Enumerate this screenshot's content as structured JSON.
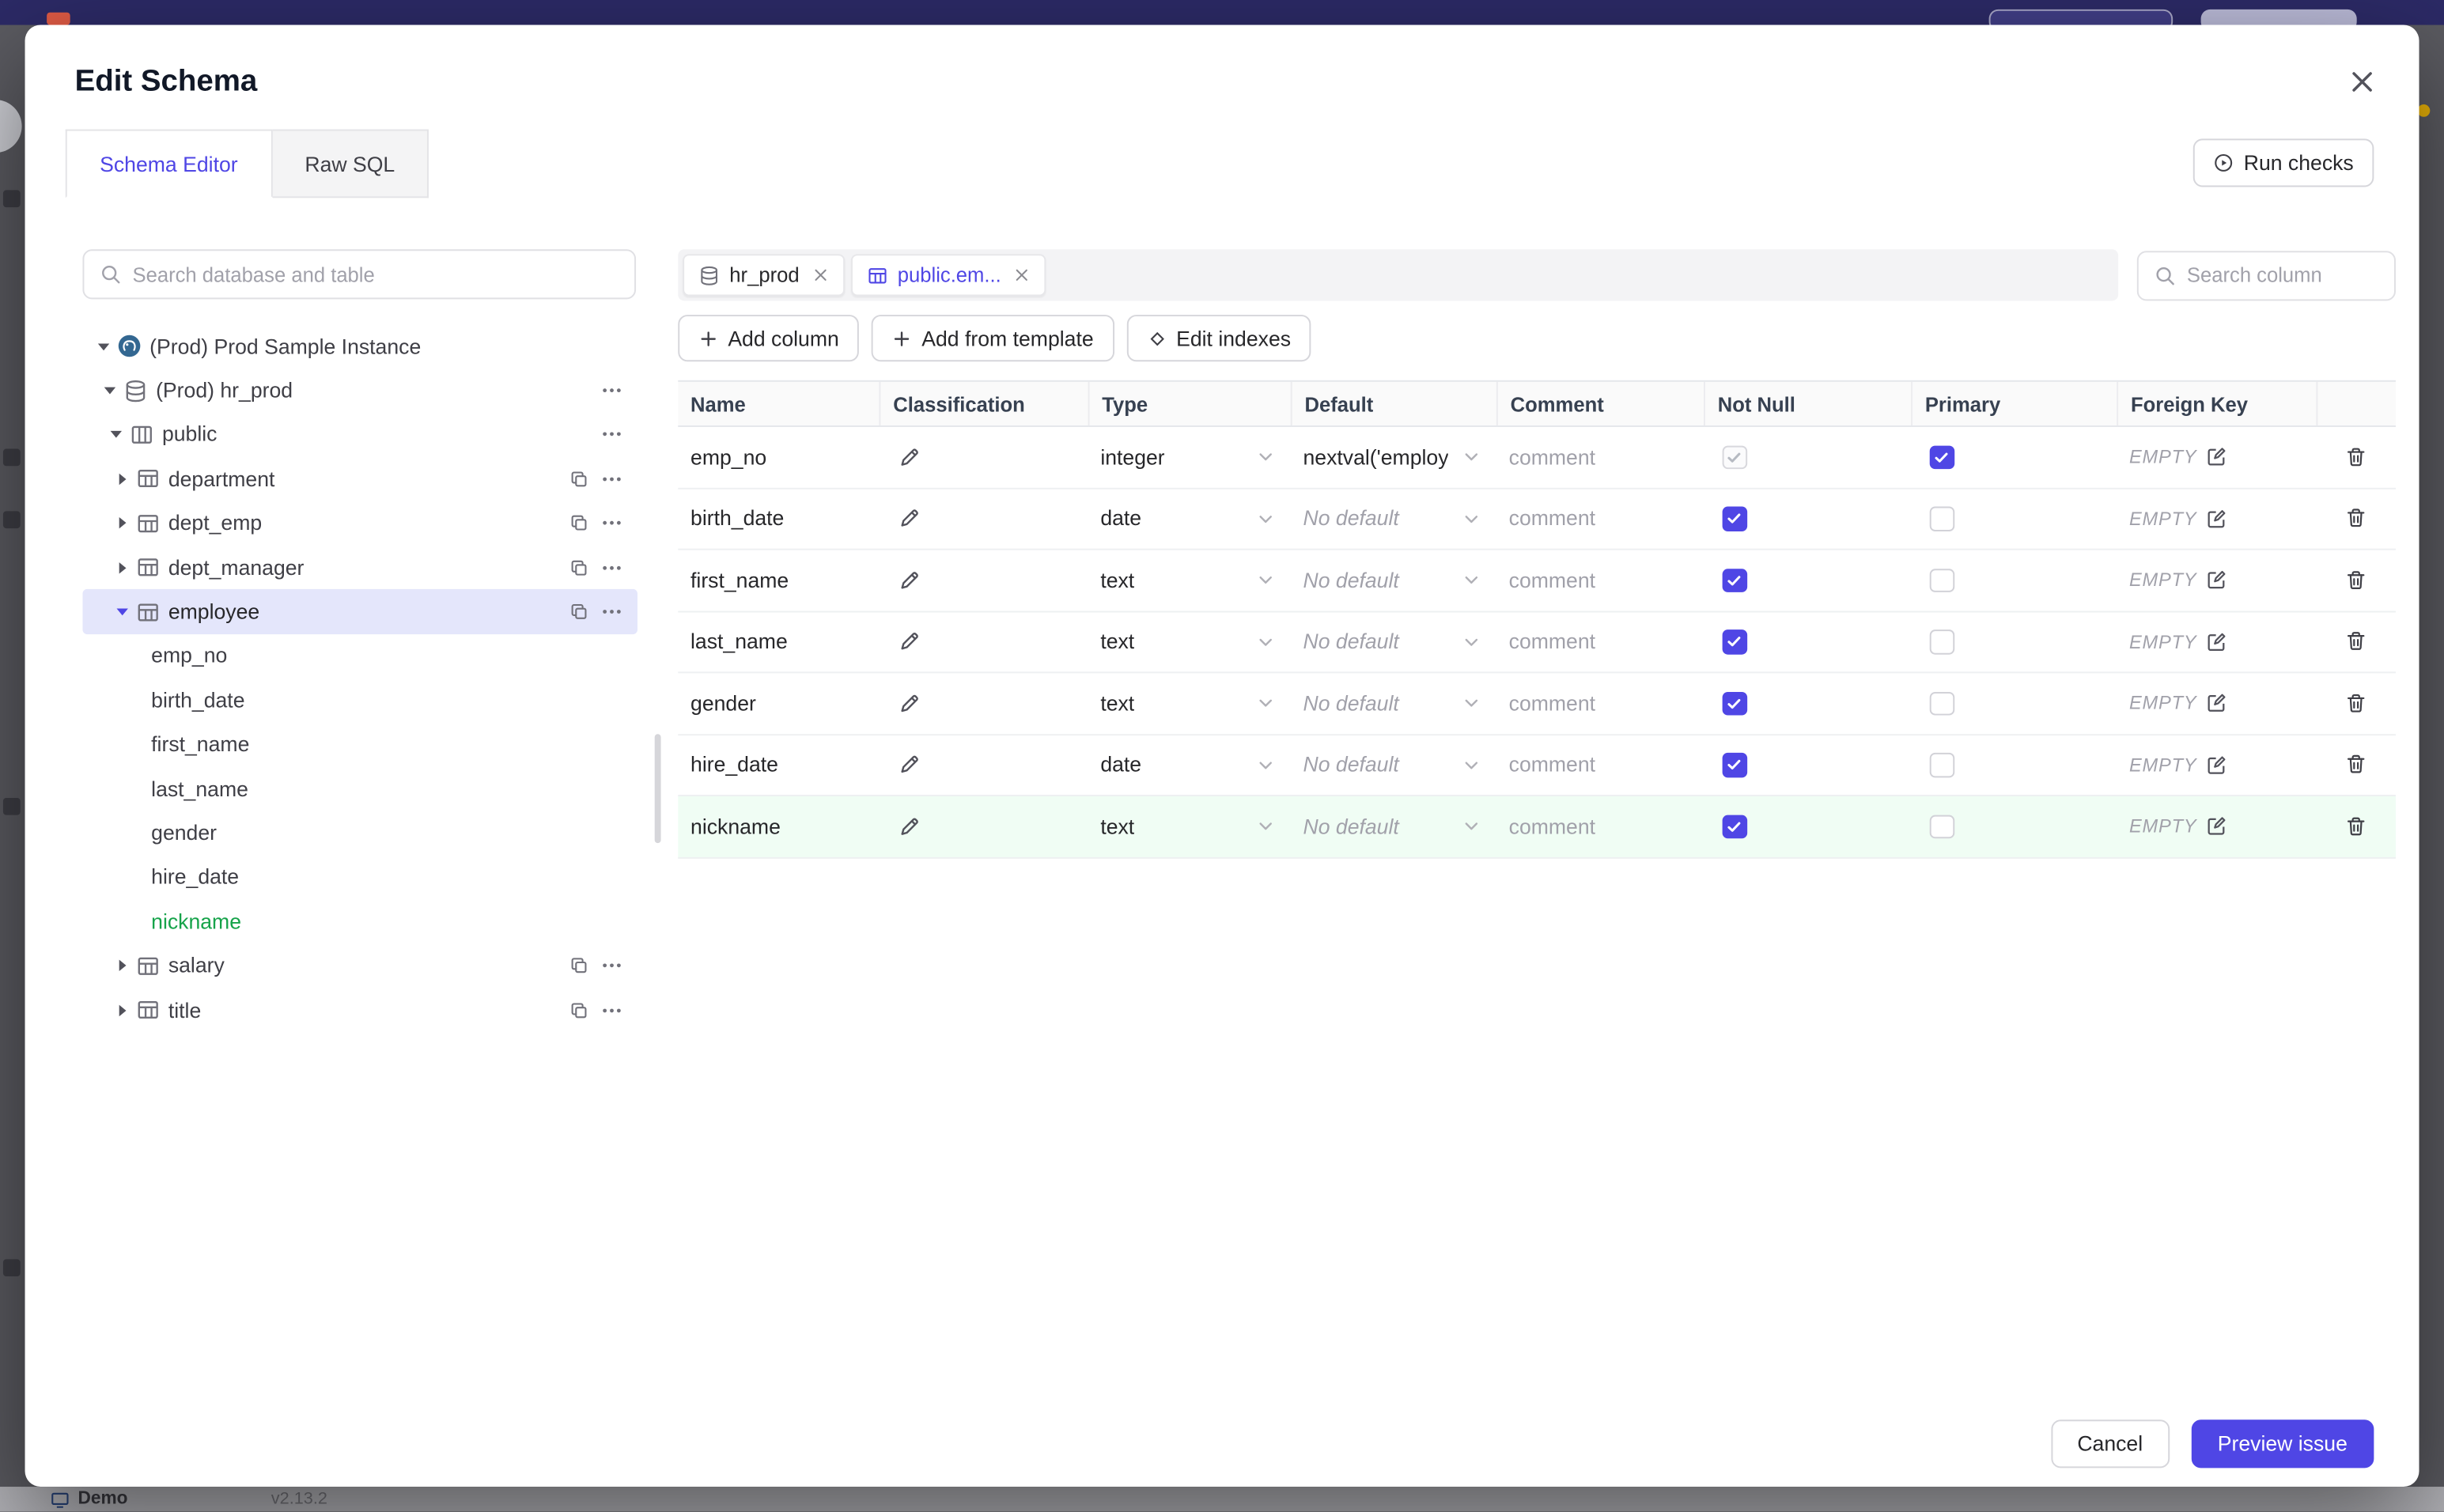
{
  "colors": {
    "accent": "#4f46e5",
    "green_text": "#16a34a",
    "green_row_bg": "#f0fdf4",
    "selected_bg": "#e4e6fb"
  },
  "backdrop": {
    "demo_label": "Demo",
    "version": "v2.13.2"
  },
  "modal": {
    "title": "Edit Schema",
    "tabs": [
      {
        "label": "Schema Editor",
        "active": true
      },
      {
        "label": "Raw SQL",
        "active": false
      }
    ],
    "run_checks_label": "Run checks",
    "sidebar": {
      "search_placeholder": "Search database and table",
      "tree": [
        {
          "label": "(Prod) Prod Sample Instance",
          "level": 0,
          "caret": "down",
          "icon": "instance"
        },
        {
          "label": "(Prod) hr_prod",
          "level": 1,
          "caret": "down",
          "icon": "database",
          "menu": true
        },
        {
          "label": "public",
          "level": 2,
          "caret": "down",
          "icon": "schema",
          "menu": true
        },
        {
          "label": "department",
          "level": 3,
          "caret": "right",
          "icon": "table",
          "copy": true,
          "menu": true
        },
        {
          "label": "dept_emp",
          "level": 3,
          "caret": "right",
          "icon": "table",
          "copy": true,
          "menu": true
        },
        {
          "label": "dept_manager",
          "level": 3,
          "caret": "right",
          "icon": "table",
          "copy": true,
          "menu": true
        },
        {
          "label": "employee",
          "level": 3,
          "caret": "down",
          "icon": "table",
          "copy": true,
          "menu": true,
          "selected": true
        },
        {
          "label": "emp_no",
          "level": 4
        },
        {
          "label": "birth_date",
          "level": 4
        },
        {
          "label": "first_name",
          "level": 4
        },
        {
          "label": "last_name",
          "level": 4
        },
        {
          "label": "gender",
          "level": 4
        },
        {
          "label": "hire_date",
          "level": 4
        },
        {
          "label": "nickname",
          "level": 4,
          "green": true
        },
        {
          "label": "salary",
          "level": 3,
          "caret": "right",
          "icon": "table",
          "copy": true,
          "menu": true
        },
        {
          "label": "title",
          "level": 3,
          "caret": "right",
          "icon": "table",
          "copy": true,
          "menu": true
        }
      ]
    },
    "main": {
      "chips": [
        {
          "label": "hr_prod",
          "icon": "database",
          "active": false
        },
        {
          "label": "public.em...",
          "icon": "table",
          "active": true
        }
      ],
      "column_search_placeholder": "Search column",
      "toolbar": {
        "add_column": "Add column",
        "add_from_template": "Add from template",
        "edit_indexes": "Edit indexes"
      },
      "table": {
        "headers": [
          "Name",
          "Classification",
          "Type",
          "Default",
          "Comment",
          "Not Null",
          "Primary",
          "Foreign Key",
          ""
        ],
        "comment_placeholder": "comment",
        "empty_label": "EMPTY",
        "rows": [
          {
            "name": "emp_no",
            "type": "integer",
            "default": "nextval('employ",
            "default_muted": false,
            "not_null": "checked-disabled",
            "primary": "checked",
            "highlight": false
          },
          {
            "name": "birth_date",
            "type": "date",
            "default": "No default",
            "default_muted": true,
            "not_null": "checked",
            "primary": "unchecked",
            "highlight": false
          },
          {
            "name": "first_name",
            "type": "text",
            "default": "No default",
            "default_muted": true,
            "not_null": "checked",
            "primary": "unchecked",
            "highlight": false
          },
          {
            "name": "last_name",
            "type": "text",
            "default": "No default",
            "default_muted": true,
            "not_null": "checked",
            "primary": "unchecked",
            "highlight": false
          },
          {
            "name": "gender",
            "type": "text",
            "default": "No default",
            "default_muted": true,
            "not_null": "checked",
            "primary": "unchecked",
            "highlight": false
          },
          {
            "name": "hire_date",
            "type": "date",
            "default": "No default",
            "default_muted": true,
            "not_null": "checked",
            "primary": "unchecked",
            "highlight": false
          },
          {
            "name": "nickname",
            "type": "text",
            "default": "No default",
            "default_muted": true,
            "not_null": "checked",
            "primary": "unchecked",
            "highlight": true
          }
        ]
      }
    },
    "footer": {
      "cancel": "Cancel",
      "primary": "Preview issue"
    }
  }
}
